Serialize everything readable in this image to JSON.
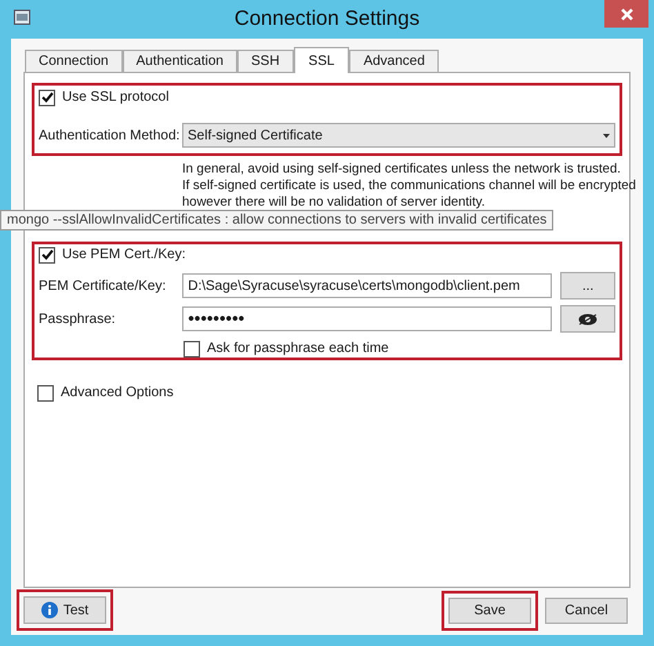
{
  "window": {
    "title": "Connection Settings"
  },
  "tabs": [
    {
      "label": "Connection",
      "selected": false
    },
    {
      "label": "Authentication",
      "selected": false
    },
    {
      "label": "SSH",
      "selected": false
    },
    {
      "label": "SSL",
      "selected": true
    },
    {
      "label": "Advanced",
      "selected": false
    }
  ],
  "ssl": {
    "highlighted": true,
    "use_ssl": {
      "label": "Use SSL protocol",
      "checked": true
    },
    "auth_method": {
      "label": "Authentication Method:",
      "value": "Self-signed Certificate"
    },
    "help": [
      "In general, avoid using self-signed certificates unless the network is trusted.",
      "If self-signed certificate is used, the communications channel will be encrypted",
      "however there will be no validation of server identity."
    ]
  },
  "tooltip": "mongo --sslAllowInvalidCertificates : allow connections to servers with invalid certificates",
  "pem": {
    "highlighted": true,
    "use_pem": {
      "label": "Use PEM Cert./Key:",
      "checked": true
    },
    "cert": {
      "label": "PEM Certificate/Key:",
      "value": "D:\\Sage\\Syracuse\\syracuse\\certs\\mongodb\\client.pem",
      "button": "..."
    },
    "passphrase": {
      "label": "Passphrase:",
      "value": "•••••••••"
    },
    "ask": {
      "label": "Ask for passphrase each time",
      "checked": false
    }
  },
  "advanced_options": {
    "label": "Advanced Options",
    "checked": false
  },
  "buttons": [
    {
      "kind": "test",
      "label": "Test",
      "highlighted": true
    },
    {
      "kind": "save",
      "label": "Save",
      "highlighted": true
    },
    {
      "kind": "cancel",
      "label": "Cancel",
      "highlighted": false
    }
  ]
}
